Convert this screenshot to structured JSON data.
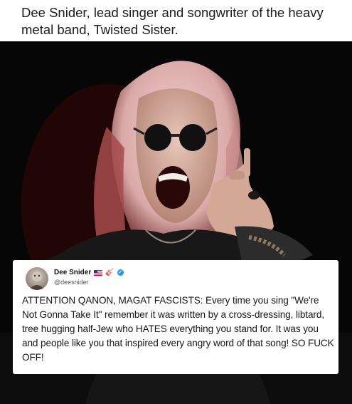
{
  "post": {
    "caption": "Dee Snider, lead singer and songwriter of the heavy metal band, Twisted Sister."
  },
  "tweet": {
    "author": "Dee Snider",
    "flag_icon": "us-flag-icon",
    "badge_icon": "guitar-icon",
    "guitar_glyph": "🎸",
    "verified_icon": "verified-badge-icon",
    "verified_glyph": "✓",
    "handle": "@deesnider",
    "text": "ATTENTION QANON, MAGAT FASCISTS: Every time you sing \"We're Not Gonna Take It\" remember it was written by a cross-dressing, libtard, tree hugging half-Jew who HATES everything you stand for. It was you and people like you that inspired every angry word of that song! SO FUCK OFF!"
  },
  "colors": {
    "photo_background": "#060606",
    "hair": "#e8c7c5",
    "verified": "#1d9bf0"
  }
}
